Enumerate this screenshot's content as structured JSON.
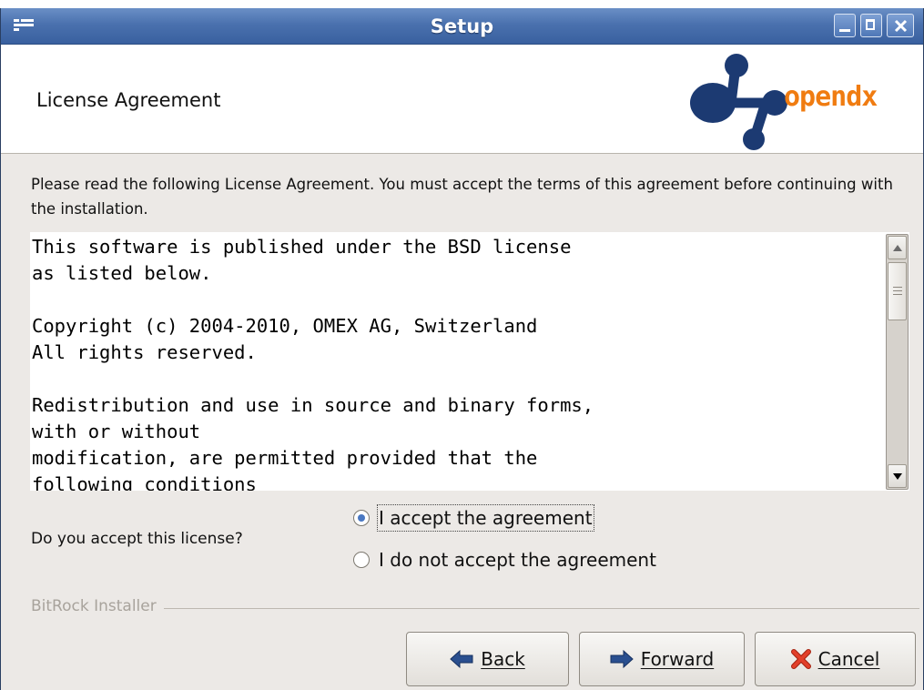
{
  "window": {
    "title": "Setup"
  },
  "header": {
    "title": "License Agreement",
    "logo_text": "opendx"
  },
  "intro_text": "Please read the following License Agreement. You must accept the terms of this agreement before continuing with the installation.",
  "license_text": "This software is published under the BSD license\nas listed below.\n\nCopyright (c) 2004-2010, OMEX AG, Switzerland\nAll rights reserved.\n\nRedistribution and use in source and binary forms,\nwith or without\nmodification, are permitted provided that the\nfollowing conditions",
  "acceptance": {
    "question": "Do you accept this license?",
    "options": [
      {
        "label": "I accept the agreement",
        "selected": true
      },
      {
        "label": "I do not accept the agreement",
        "selected": false
      }
    ]
  },
  "installer_label": "BitRock Installer",
  "buttons": {
    "back": "Back",
    "forward": "Forward",
    "cancel": "Cancel"
  },
  "colors": {
    "titlebar": "#4a71ae",
    "logo_blue": "#1c3a72",
    "logo_orange": "#f07c11",
    "cancel_red": "#d8321b",
    "arrow_blue": "#2a4f8f"
  },
  "icons": {
    "back": "arrow-left-icon",
    "forward": "arrow-right-icon",
    "cancel": "red-x-icon"
  }
}
